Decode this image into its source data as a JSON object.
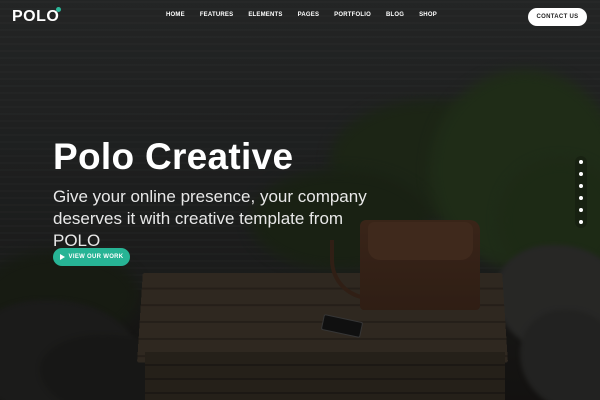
{
  "header": {
    "logo": "POLO",
    "nav": [
      "HOME",
      "FEATURES",
      "ELEMENTS",
      "PAGES",
      "PORTFOLIO",
      "BLOG",
      "SHOP"
    ],
    "contact_label": "CONTACT US"
  },
  "hero": {
    "title": "Polo Creative",
    "subtitle": "Give your online presence, your company deserves it with creative template from POLO",
    "cta_label": "VIEW OUR WORK",
    "cta_icon": "play-icon"
  },
  "slider": {
    "dot_count": 6
  },
  "colors": {
    "accent": "#27b495",
    "text": "#ffffff",
    "contact_button_bg": "#ffffff"
  }
}
